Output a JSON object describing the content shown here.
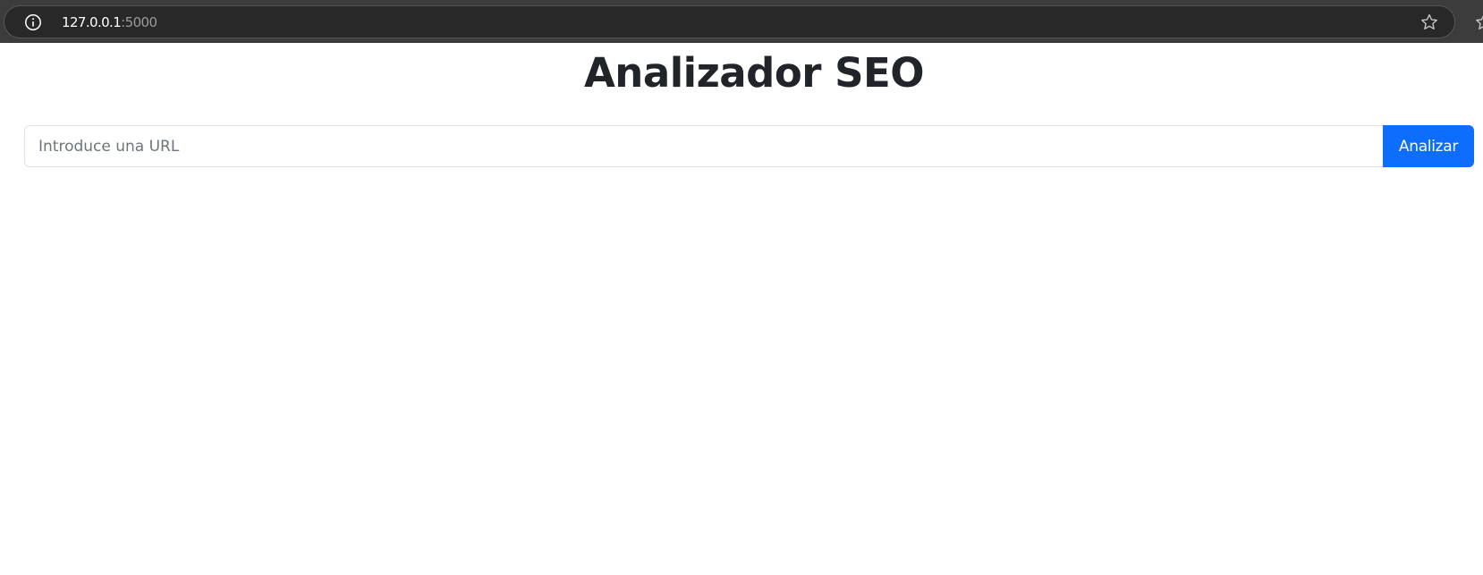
{
  "browser": {
    "url_host": "127.0.0.1",
    "url_port": ":5000",
    "icons": [
      "info-icon",
      "star-icon"
    ]
  },
  "page": {
    "title": "Analizador SEO"
  },
  "form": {
    "input_value": "",
    "input_placeholder": "Introduce una URL",
    "submit_label": "Analizar",
    "accent_color": "#0d6efd"
  }
}
